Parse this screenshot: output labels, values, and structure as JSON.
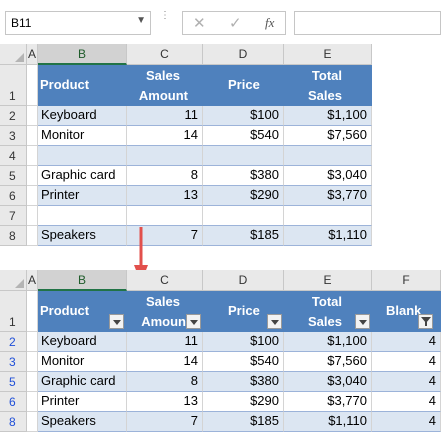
{
  "formula_bar": {
    "name_box": "B11",
    "cancel_icon": "✕",
    "enter_icon": "✓",
    "fx_label": "fx",
    "formula": ""
  },
  "columns_top": [
    "A",
    "B",
    "C",
    "D",
    "E"
  ],
  "columns_bottom": [
    "A",
    "B",
    "C",
    "D",
    "E",
    "F"
  ],
  "table_top": {
    "headers": {
      "product": "Product",
      "sales_line1": "Sales",
      "sales_line2": "Amount",
      "price": "Price",
      "total_line1": "Total",
      "total_line2": "Sales"
    },
    "row_numbers": [
      "1",
      "2",
      "3",
      "4",
      "5",
      "6",
      "7",
      "8"
    ],
    "rows": [
      {
        "product": "Keyboard",
        "amount": "11",
        "price": "$100",
        "total": "$1,100"
      },
      {
        "product": "Monitor",
        "amount": "14",
        "price": "$540",
        "total": "$7,560"
      },
      {
        "product": "",
        "amount": "",
        "price": "",
        "total": ""
      },
      {
        "product": "Graphic card",
        "amount": "8",
        "price": "$380",
        "total": "$3,040"
      },
      {
        "product": "Printer",
        "amount": "13",
        "price": "$290",
        "total": "$3,770"
      },
      {
        "product": "",
        "amount": "",
        "price": "",
        "total": ""
      },
      {
        "product": "Speakers",
        "amount": "7",
        "price": "$185",
        "total": "$1,110"
      }
    ]
  },
  "table_bottom": {
    "headers": {
      "product": "Product",
      "sales_line1": "Sales",
      "sales_line2": "Amoun",
      "price": "Price",
      "total_line1": "Total",
      "total_line2": "Sales",
      "blank": "Blank"
    },
    "row_numbers": [
      "1",
      "2",
      "3",
      "5",
      "6",
      "8"
    ],
    "rows": [
      {
        "product": "Keyboard",
        "amount": "11",
        "price": "$100",
        "total": "$1,100",
        "blank": "4"
      },
      {
        "product": "Monitor",
        "amount": "14",
        "price": "$540",
        "total": "$7,560",
        "blank": "4"
      },
      {
        "product": "Graphic card",
        "amount": "8",
        "price": "$380",
        "total": "$3,040",
        "blank": "4"
      },
      {
        "product": "Printer",
        "amount": "13",
        "price": "$290",
        "total": "$3,770",
        "blank": "4"
      },
      {
        "product": "Speakers",
        "amount": "7",
        "price": "$185",
        "total": "$1,110",
        "blank": "4"
      }
    ]
  },
  "colors": {
    "header_fill": "#4f81bd",
    "band_fill": "#dce6f2",
    "arrow": "#e2504c",
    "filtered_row_number": "#1f4fd8"
  }
}
